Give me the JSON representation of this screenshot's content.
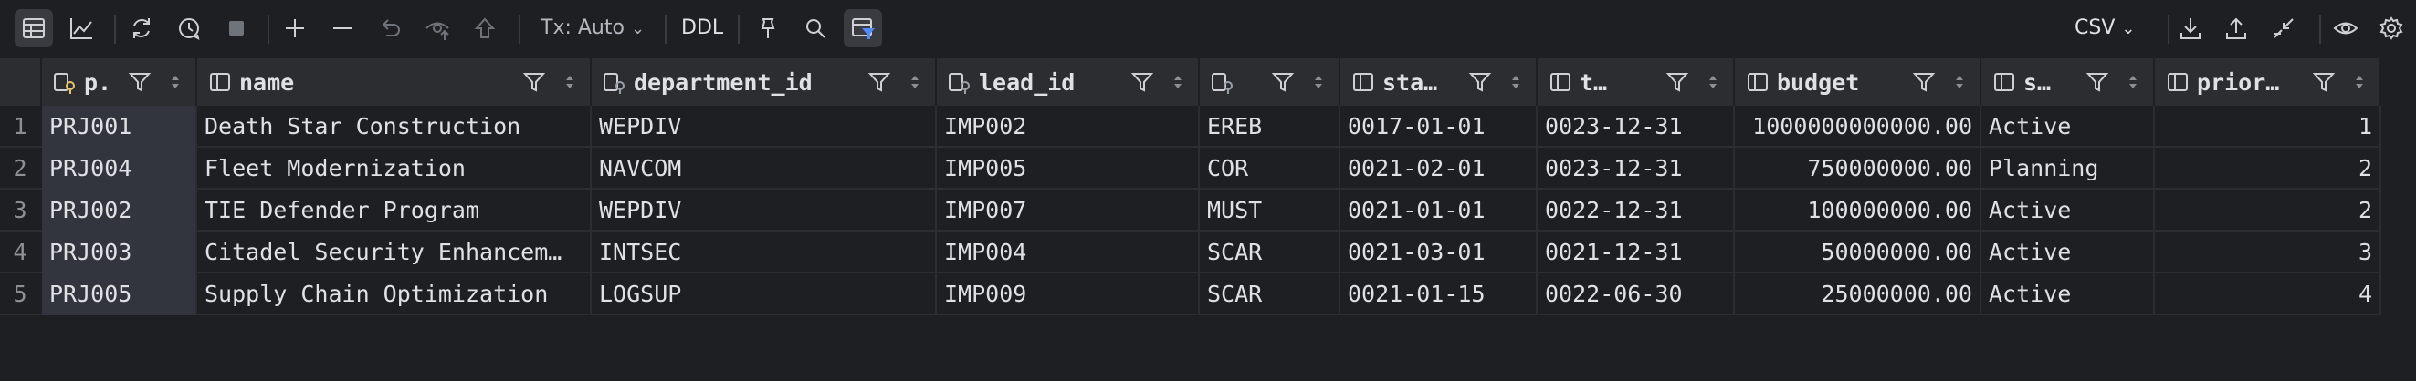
{
  "toolbar": {
    "tx_mode": "Tx: Auto",
    "ddl_label": "DDL",
    "export_format": "CSV"
  },
  "columns": [
    {
      "name": "p.",
      "icon": "key-column-icon"
    },
    {
      "name": "name",
      "icon": "column-icon"
    },
    {
      "name": "department_id",
      "icon": "foreign-key-column-icon"
    },
    {
      "name": "lead_id",
      "icon": "foreign-key-column-icon"
    },
    {
      "name": "",
      "icon": "foreign-key-column-icon"
    },
    {
      "name": "sta…",
      "icon": "column-icon"
    },
    {
      "name": "t…",
      "icon": "column-icon"
    },
    {
      "name": "budget",
      "icon": "column-icon"
    },
    {
      "name": "s…",
      "icon": "column-icon"
    },
    {
      "name": "prior…",
      "icon": "column-icon"
    }
  ],
  "rows": [
    {
      "num": "1",
      "cells": [
        "PRJ001",
        "Death Star Construction",
        "WEPDIV",
        "IMP002",
        "EREB",
        "0017-01-01",
        "0023-12-31",
        "1000000000000.00",
        "Active",
        "1"
      ]
    },
    {
      "num": "2",
      "cells": [
        "PRJ004",
        "Fleet Modernization",
        "NAVCOM",
        "IMP005",
        "COR",
        "0021-02-01",
        "0023-12-31",
        "750000000.00",
        "Planning",
        "2"
      ]
    },
    {
      "num": "3",
      "cells": [
        "PRJ002",
        "TIE Defender Program",
        "WEPDIV",
        "IMP007",
        "MUST",
        "0021-01-01",
        "0022-12-31",
        "100000000.00",
        "Active",
        "2"
      ]
    },
    {
      "num": "4",
      "cells": [
        "PRJ003",
        "Citadel Security Enhancem…",
        "INTSEC",
        "IMP004",
        "SCAR",
        "0021-03-01",
        "0021-12-31",
        "50000000.00",
        "Active",
        "3"
      ]
    },
    {
      "num": "5",
      "cells": [
        "PRJ005",
        "Supply Chain Optimization",
        "LOGSUP",
        "IMP009",
        "SCAR",
        "0021-01-15",
        "0022-06-30",
        "25000000.00",
        "Active",
        "4"
      ]
    }
  ]
}
